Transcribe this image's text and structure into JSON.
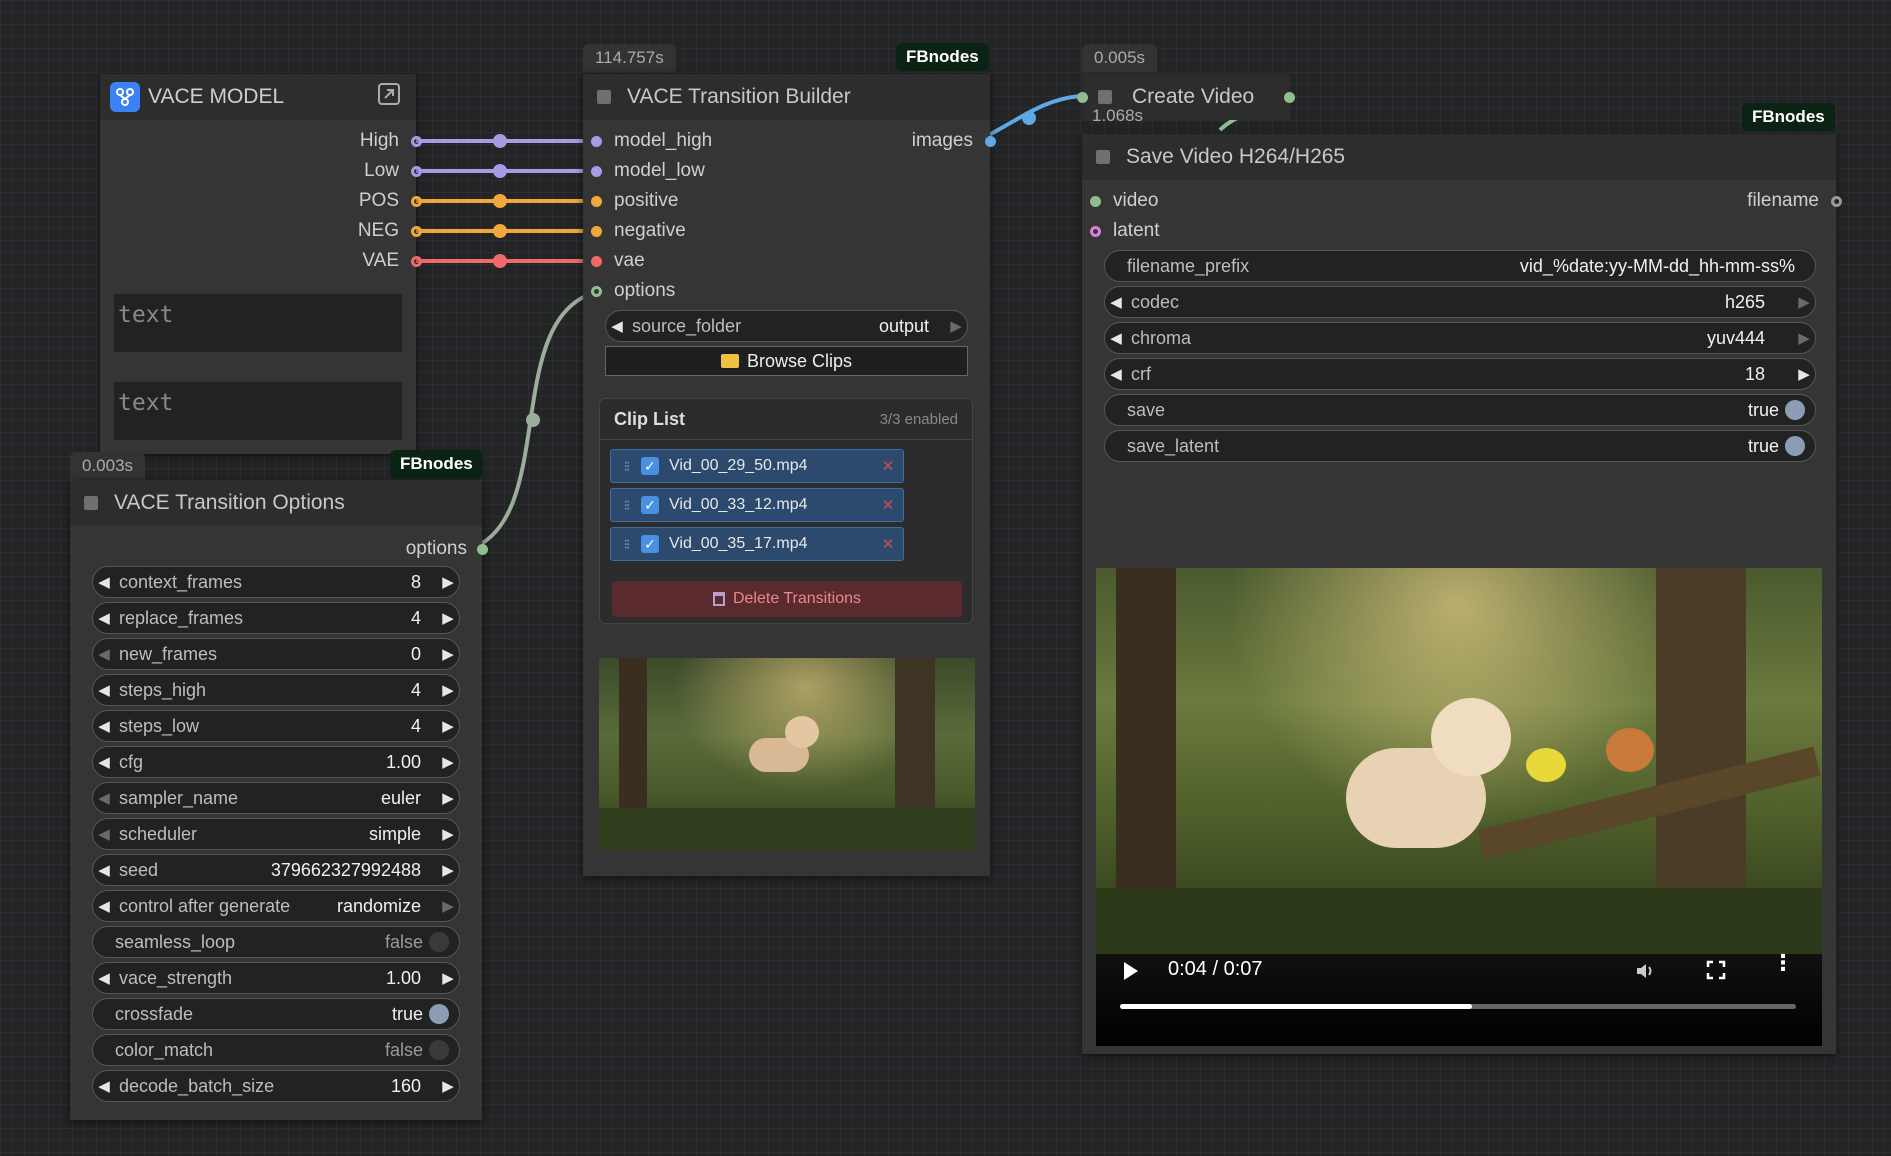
{
  "colors": {
    "high": "#a79be6",
    "low": "#a79be6",
    "pos": "#f0a83a",
    "neg": "#f0a83a",
    "vae": "#f06a6a",
    "options": "#8fbf8f",
    "images": "#5ea8e6",
    "video": "#8fbf8f"
  },
  "vace_model": {
    "title": "VACE MODEL",
    "outputs": [
      "High",
      "Low",
      "POS",
      "NEG",
      "VAE"
    ],
    "text1": "text",
    "text2": "text"
  },
  "builder": {
    "time": "114.757s",
    "badge": "FBnodes",
    "title": "VACE Transition Builder",
    "inputs": [
      "model_high",
      "model_low",
      "positive",
      "negative",
      "vae",
      "options"
    ],
    "output": "images",
    "source_folder_label": "source_folder",
    "source_folder_value": "output",
    "browse_label": "Browse Clips",
    "clip_list_title": "Clip List",
    "clip_list_count": "3/3 enabled",
    "clips": [
      "Vid_00_29_50.mp4",
      "Vid_00_33_12.mp4",
      "Vid_00_35_17.mp4"
    ],
    "delete_label": "Delete Transitions"
  },
  "options": {
    "time": "0.003s",
    "badge": "FBnodes",
    "title": "VACE Transition Options",
    "output": "options",
    "widgets": [
      {
        "label": "context_frames",
        "value": "8"
      },
      {
        "label": "replace_frames",
        "value": "4"
      },
      {
        "label": "new_frames",
        "value": "0"
      },
      {
        "label": "steps_high",
        "value": "4"
      },
      {
        "label": "steps_low",
        "value": "4"
      },
      {
        "label": "cfg",
        "value": "1.00"
      },
      {
        "label": "sampler_name",
        "value": "euler"
      },
      {
        "label": "scheduler",
        "value": "simple"
      },
      {
        "label": "seed",
        "value": "379662327992488"
      },
      {
        "label": "control after generate",
        "value": "randomize"
      },
      {
        "label": "seamless_loop",
        "value": "false"
      },
      {
        "label": "vace_strength",
        "value": "1.00"
      },
      {
        "label": "crossfade",
        "value": "true"
      },
      {
        "label": "color_match",
        "value": "false"
      },
      {
        "label": "decode_batch_size",
        "value": "160"
      }
    ]
  },
  "create_video": {
    "time": "0.005s",
    "title": "Create Video"
  },
  "save_video": {
    "time": "1.068s",
    "badge": "FBnodes",
    "title": "Save Video H264/H265",
    "inputs": [
      "video",
      "latent"
    ],
    "output": "filename",
    "widgets": [
      {
        "label": "filename_prefix",
        "value": "vid_%date:yy-MM-dd_hh-mm-ss%"
      },
      {
        "label": "codec",
        "value": "h265"
      },
      {
        "label": "chroma",
        "value": "yuv444"
      },
      {
        "label": "crf",
        "value": "18"
      },
      {
        "label": "save",
        "value": "true"
      },
      {
        "label": "save_latent",
        "value": "true"
      }
    ],
    "player": {
      "time": "0:04 / 0:07",
      "progress": 0.52
    }
  }
}
